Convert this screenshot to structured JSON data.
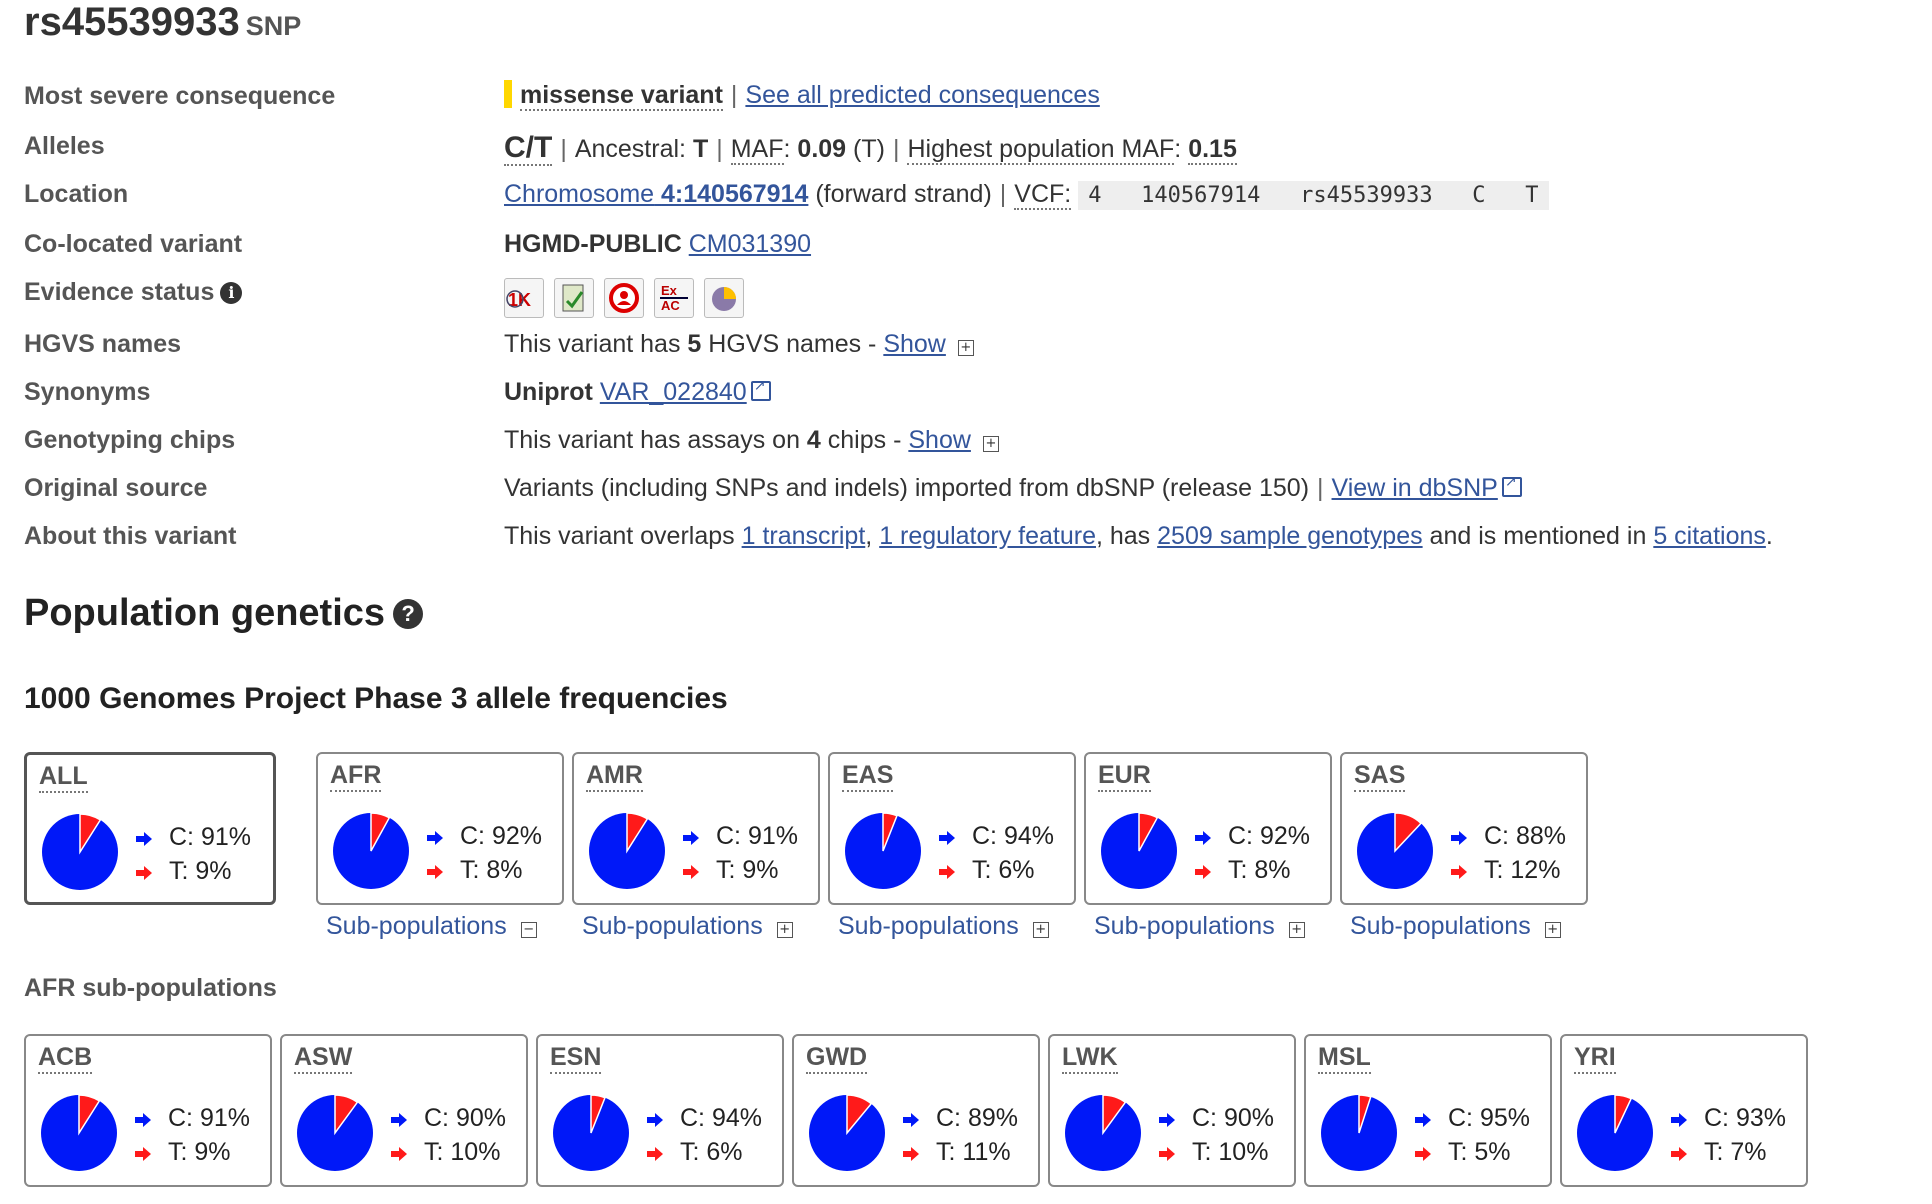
{
  "header": {
    "id": "rs45539933",
    "type": "SNP"
  },
  "summary": {
    "consequence": {
      "label": "Most severe consequence",
      "value": "missense variant",
      "link": "See all predicted consequences",
      "marker_color": "#ffd700"
    },
    "alleles": {
      "label": "Alleles",
      "allele": "C/T",
      "ancestral_label": "Ancestral:",
      "ancestral": "T",
      "maf_label": "MAF",
      "maf": "0.09",
      "maf_allele": "(T)",
      "highest_label": "Highest population MAF",
      "highest": "0.15"
    },
    "location": {
      "label": "Location",
      "chrom_link": "Chromosome",
      "chrom_pos": "4:140567914",
      "strand": "(forward strand)",
      "vcf_label": "VCF:",
      "vcf": "4   140567914   rs45539933   C   T"
    },
    "colocated": {
      "label": "Co-located variant",
      "source": "HGMD-PUBLIC",
      "link": "CM031390"
    },
    "evidence": {
      "label": "Evidence status",
      "icons": [
        "1000-genomes-icon",
        "frequency-icon",
        "cited-icon",
        "exac-icon",
        "phenotype-icon"
      ]
    },
    "hgvs": {
      "label": "HGVS names",
      "pre": "This variant has ",
      "count": "5",
      "post": " HGVS names - ",
      "link": "Show"
    },
    "synonyms": {
      "label": "Synonyms",
      "source": "Uniprot",
      "link": "VAR_022840"
    },
    "chips": {
      "label": "Genotyping chips",
      "pre": "This variant has assays on ",
      "count": "4",
      "post": " chips - ",
      "link": "Show"
    },
    "source": {
      "label": "Original source",
      "text": "Variants (including SNPs and indels) imported from dbSNP (release 150)",
      "link": "View in dbSNP"
    },
    "about": {
      "label": "About this variant",
      "t1": "This variant overlaps ",
      "l1": "1 transcript",
      "t2": ", ",
      "l2": "1 regulatory feature",
      "t3": ", has ",
      "l3": "2509 sample genotypes",
      "t4": " and is mentioned in ",
      "l4": "5 citations",
      "t5": "."
    }
  },
  "population": {
    "heading": "Population genetics",
    "phase_heading": "1000 Genomes Project Phase 3 allele frequencies",
    "subpop_label": "Sub-populations",
    "afr_heading": "AFR sub-populations",
    "colors": {
      "c": "#0018f8",
      "t": "#ff1a1a"
    },
    "main": [
      {
        "name": "ALL",
        "c": "C: 91%",
        "t": "T: 9%",
        "t_frac": 0.09,
        "selected": true
      },
      {
        "name": "AFR",
        "c": "C: 92%",
        "t": "T: 8%",
        "t_frac": 0.08,
        "expanded": true
      },
      {
        "name": "AMR",
        "c": "C: 91%",
        "t": "T: 9%",
        "t_frac": 0.09
      },
      {
        "name": "EAS",
        "c": "C: 94%",
        "t": "T: 6%",
        "t_frac": 0.06
      },
      {
        "name": "EUR",
        "c": "C: 92%",
        "t": "T: 8%",
        "t_frac": 0.08
      },
      {
        "name": "SAS",
        "c": "C: 88%",
        "t": "T: 12%",
        "t_frac": 0.12
      }
    ],
    "afr": [
      {
        "name": "ACB",
        "c": "C: 91%",
        "t": "T: 9%",
        "t_frac": 0.09
      },
      {
        "name": "ASW",
        "c": "C: 90%",
        "t": "T: 10%",
        "t_frac": 0.1
      },
      {
        "name": "ESN",
        "c": "C: 94%",
        "t": "T: 6%",
        "t_frac": 0.06
      },
      {
        "name": "GWD",
        "c": "C: 89%",
        "t": "T: 11%",
        "t_frac": 0.11
      },
      {
        "name": "LWK",
        "c": "C: 90%",
        "t": "T: 10%",
        "t_frac": 0.1
      },
      {
        "name": "MSL",
        "c": "C: 95%",
        "t": "T: 5%",
        "t_frac": 0.05
      },
      {
        "name": "YRI",
        "c": "C: 93%",
        "t": "T: 7%",
        "t_frac": 0.07
      }
    ]
  }
}
